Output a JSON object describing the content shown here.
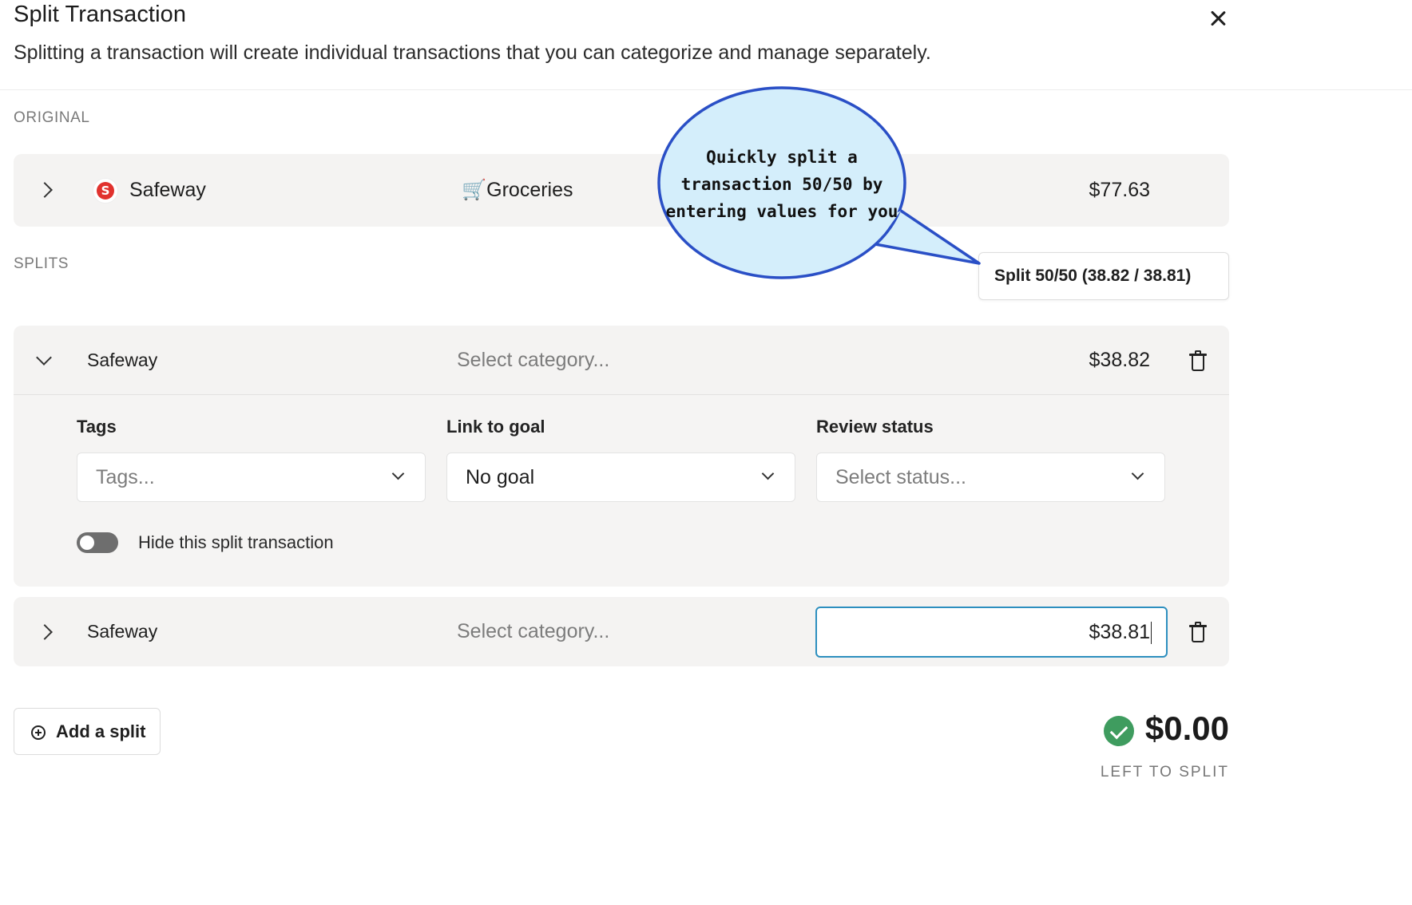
{
  "dialog": {
    "title": "Split Transaction",
    "subtitle": "Splitting a transaction will create individual transactions that you can categorize and manage separately."
  },
  "original": {
    "section_label": "ORIGINAL",
    "merchant": "Safeway",
    "merchant_logo_letter": "S",
    "category_icon": "🛒",
    "category": "Groceries",
    "amount": "$77.63"
  },
  "splits_section": {
    "label": "SPLITS",
    "split_5050_button": "Split 50/50 (38.82 / 38.81)"
  },
  "callout": {
    "line1": "Quickly split a",
    "line2": "transaction 50/50 by",
    "line3": "entering values for you"
  },
  "splits": [
    {
      "merchant": "Safeway",
      "category_placeholder": "Select category...",
      "amount": "$38.82",
      "expanded": true,
      "tags_label": "Tags",
      "tags_placeholder": "Tags...",
      "goal_label": "Link to goal",
      "goal_value": "No goal",
      "review_label": "Review status",
      "review_placeholder": "Select status...",
      "hide_label": "Hide this split transaction",
      "hidden": false
    },
    {
      "merchant": "Safeway",
      "category_placeholder": "Select category...",
      "amount": "$38.81",
      "expanded": false
    }
  ],
  "footer": {
    "add_split_label": "Add a split",
    "left_amount": "$0.00",
    "left_label": "LEFT TO SPLIT"
  },
  "colors": {
    "card_bg": "#f4f3f2",
    "focus_border": "#2d8fbf",
    "success": "#3f9c5f",
    "callout_fill": "#d4eefb",
    "callout_stroke": "#2a4fc6"
  }
}
